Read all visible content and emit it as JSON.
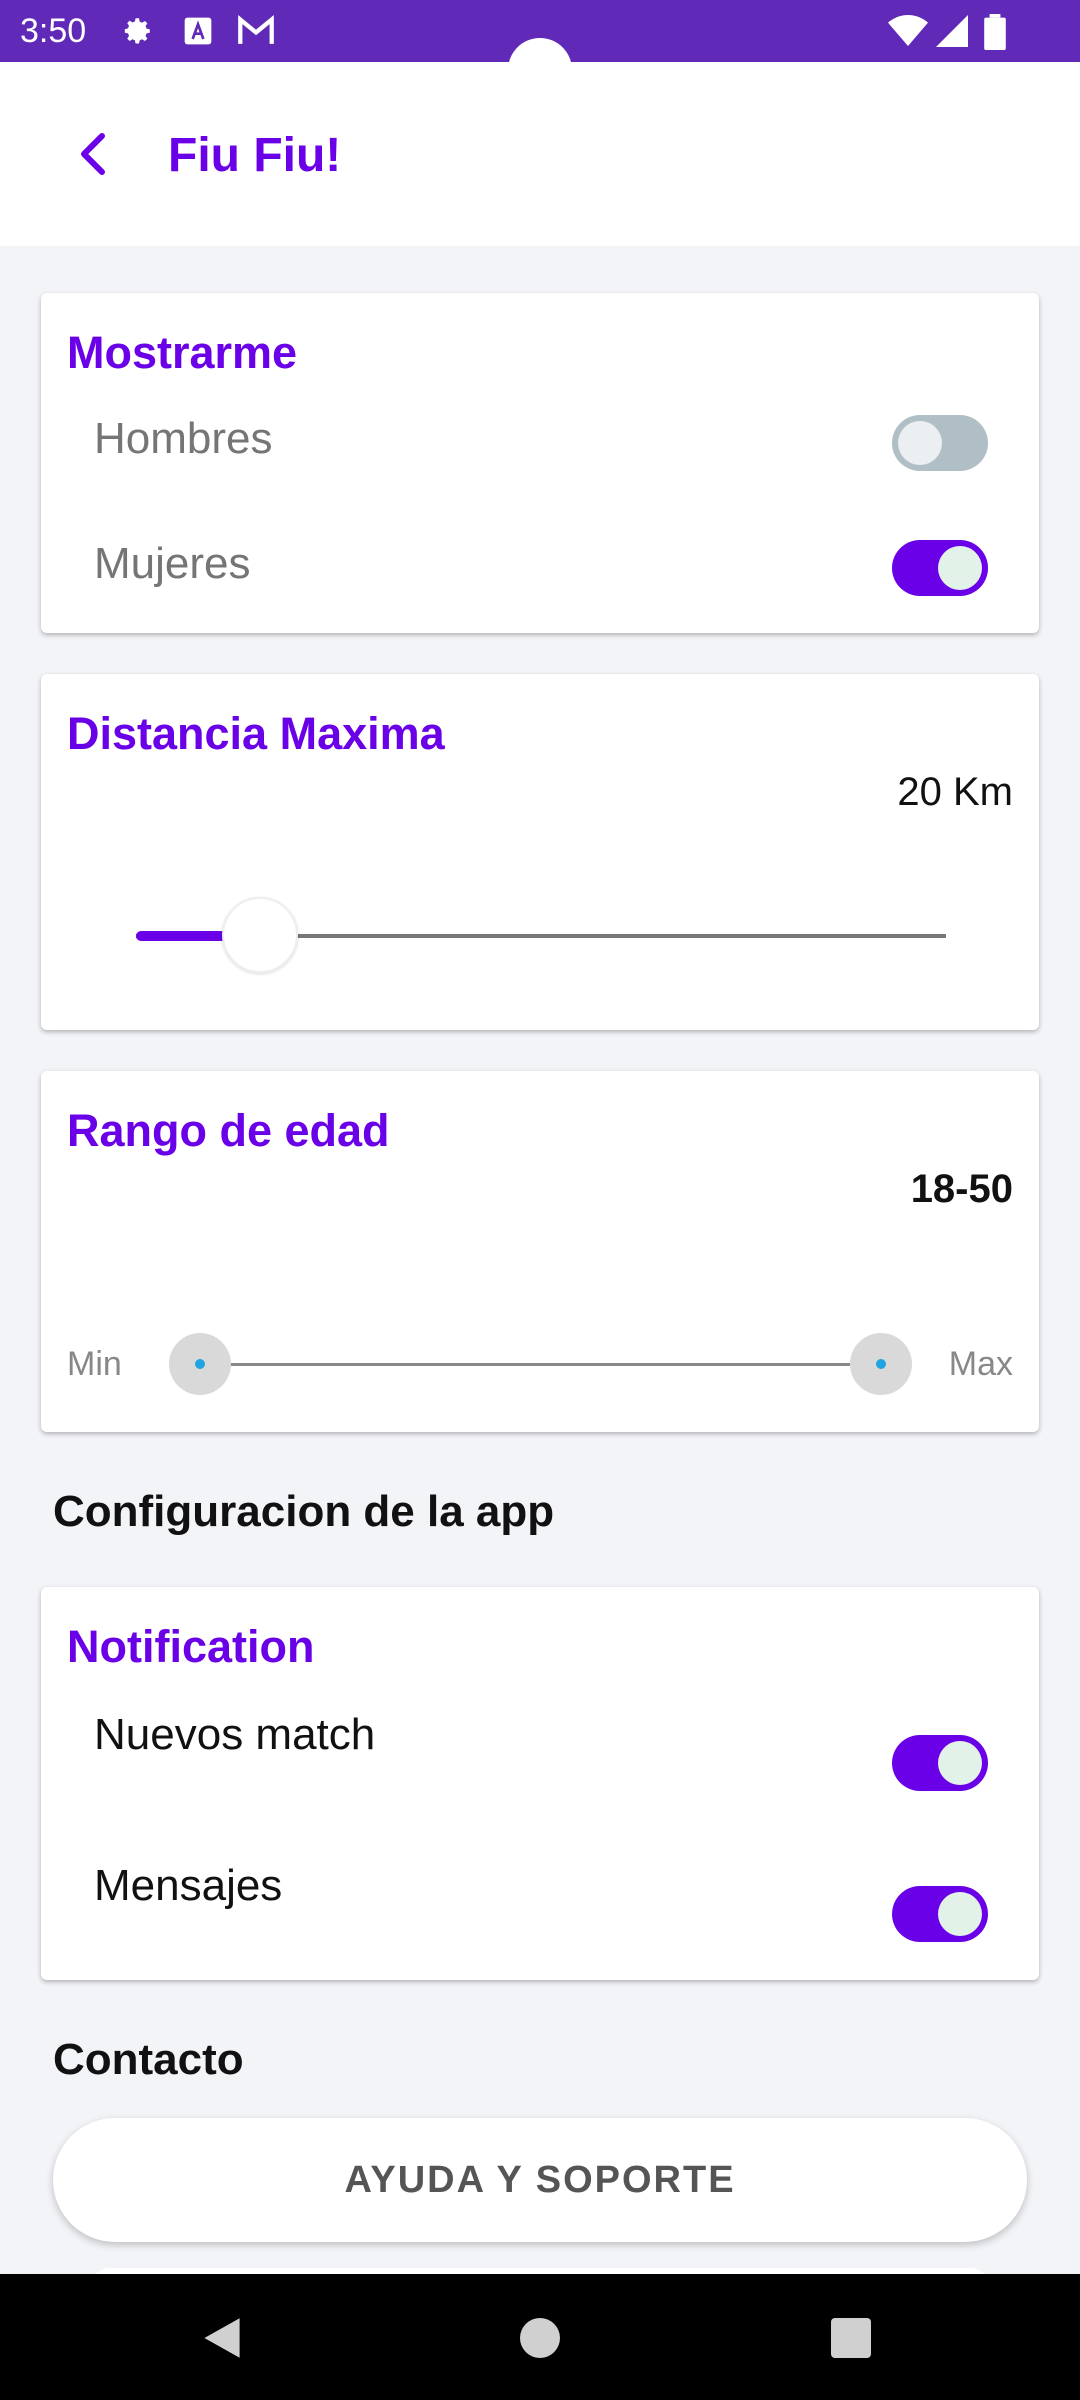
{
  "status_bar": {
    "time": "3:50",
    "icons_left": [
      "gear-icon",
      "font-a-icon",
      "gmail-icon"
    ],
    "icons_right": [
      "wifi-icon",
      "signal-icon",
      "battery-icon"
    ]
  },
  "app_bar": {
    "title": "Fiu Fiu!",
    "back_icon": "chevron-left-icon"
  },
  "show_me": {
    "title": "Mostrarme",
    "items": [
      {
        "label": "Hombres",
        "enabled": false
      },
      {
        "label": "Mujeres",
        "enabled": true
      }
    ]
  },
  "distance": {
    "title": "Distancia Maxima",
    "value_text": "20 Km",
    "slider_fraction": 0.15
  },
  "age": {
    "title": "Rango de edad",
    "value_text": "18-50",
    "min_label": "Min",
    "max_label": "Max",
    "range_low_fraction": 0.0,
    "range_high_fraction": 1.0
  },
  "app_config": {
    "header": "Configuracion de la app"
  },
  "notification": {
    "title": "Notification",
    "items": [
      {
        "label": "Nuevos match",
        "enabled": true
      },
      {
        "label": "Mensajes",
        "enabled": true
      }
    ]
  },
  "contact": {
    "header": "Contacto",
    "help_button": "AYUDA Y SOPORTE"
  },
  "colors": {
    "accent": "#6a00e8",
    "status_bar": "#6029b8",
    "toggle_off": "#b0bec5"
  }
}
